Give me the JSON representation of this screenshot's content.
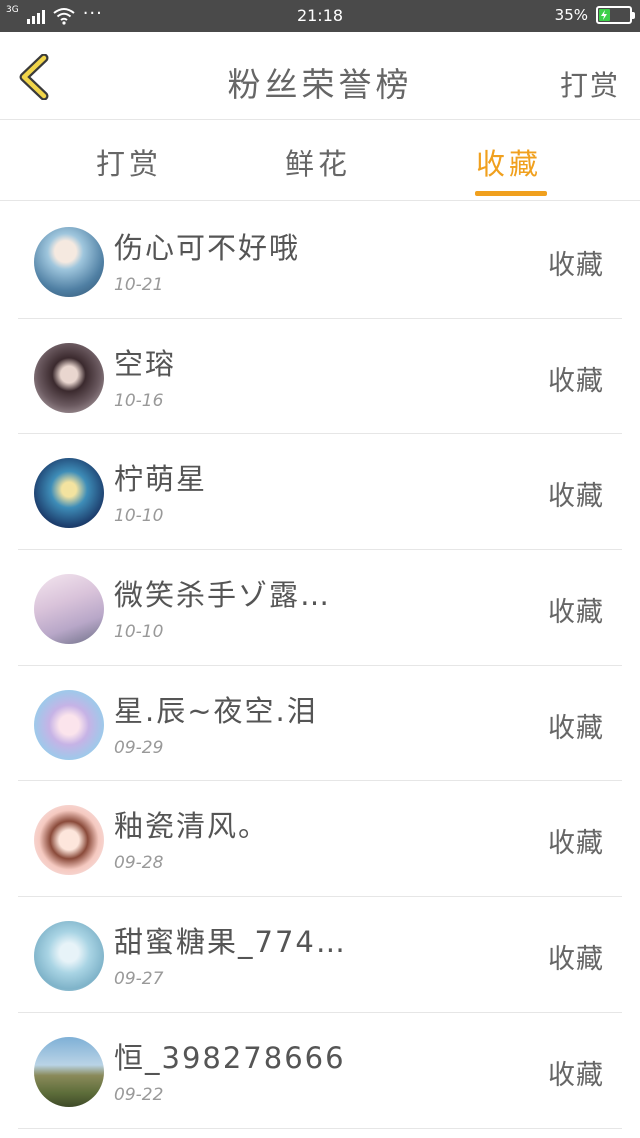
{
  "status_bar": {
    "network": "3G",
    "dots": "···",
    "time": "21:18",
    "battery": "35%",
    "battery_level": 0.35
  },
  "header": {
    "title": "粉丝荣誉榜",
    "action": "打赏",
    "back_icon": "chevron-left-icon"
  },
  "tabs": [
    {
      "label": "打赏",
      "active": false
    },
    {
      "label": "鲜花",
      "active": false
    },
    {
      "label": "收藏",
      "active": true
    }
  ],
  "colors": {
    "accent": "#f0a01e",
    "status_bar": "#4a4a4a",
    "divider": "#e6e6e6",
    "back_icon_fill": "#f1d54a"
  },
  "items": [
    {
      "name": "伤心可不好哦",
      "date": "10-21",
      "action": "收藏"
    },
    {
      "name": "空瑢",
      "date": "10-16",
      "action": "收藏"
    },
    {
      "name": "柠萌星",
      "date": "10-10",
      "action": "收藏"
    },
    {
      "name": "微笑杀手ゾ露…",
      "date": "10-10",
      "action": "收藏"
    },
    {
      "name": "星.辰~夜空.泪",
      "date": "09-29",
      "action": "收藏"
    },
    {
      "name": "釉瓷清风。",
      "date": "09-28",
      "action": "收藏"
    },
    {
      "name": "甜蜜糖果_774…",
      "date": "09-27",
      "action": "收藏"
    },
    {
      "name": "恒_398278666",
      "date": "09-22",
      "action": "收藏"
    }
  ]
}
